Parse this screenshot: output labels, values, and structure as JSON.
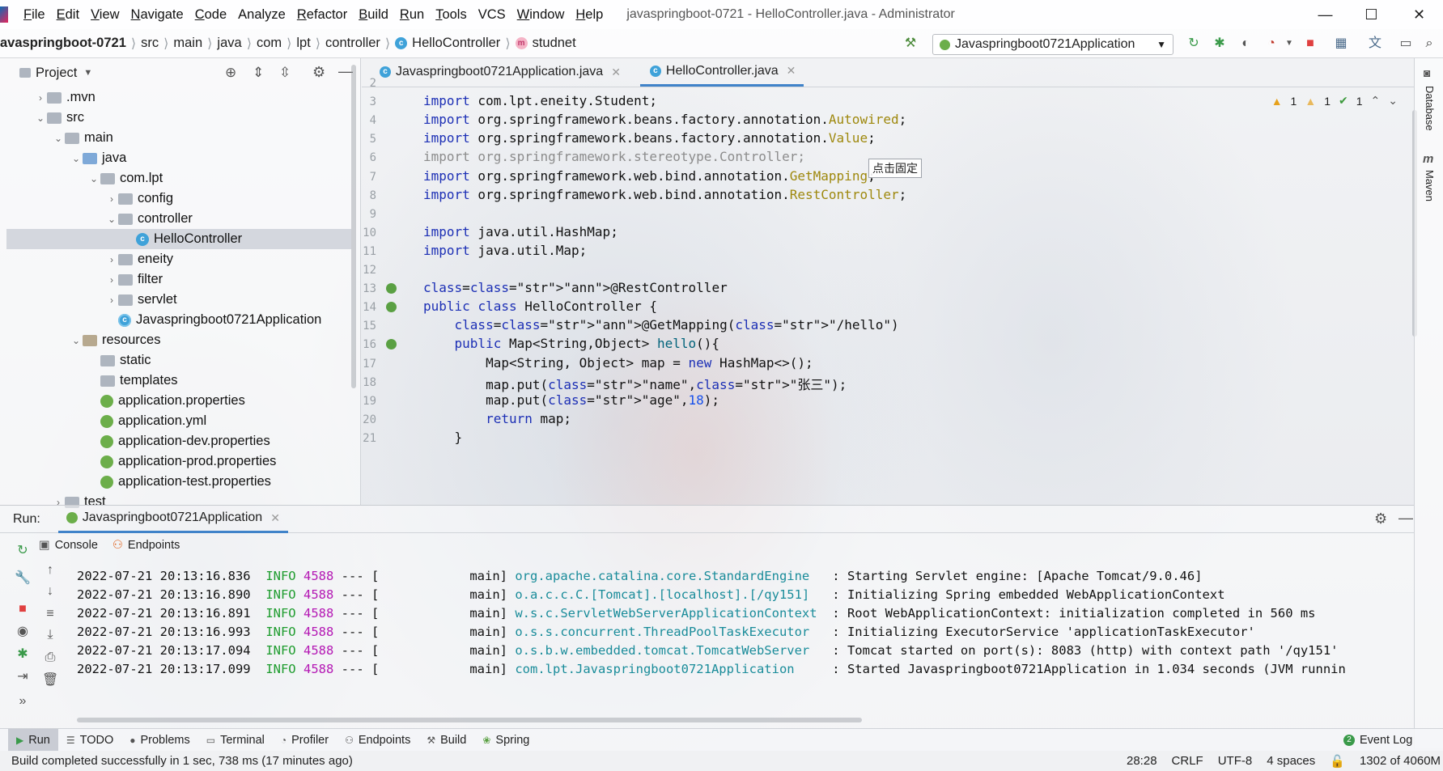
{
  "window": {
    "title": "javaspringboot-0721 - HelloController.java - Administrator",
    "controls": {
      "minimize": "—",
      "maximize": "☐",
      "close": "✕"
    }
  },
  "menu": [
    {
      "label": "File",
      "mn": "F",
      "rest": "ile"
    },
    {
      "label": "Edit",
      "mn": "E",
      "rest": "dit"
    },
    {
      "label": "View",
      "mn": "V",
      "rest": "iew"
    },
    {
      "label": "Navigate",
      "mn": "N",
      "rest": "avigate"
    },
    {
      "label": "Code",
      "mn": "C",
      "rest": "ode"
    },
    {
      "label": "Analyze",
      "mn": "",
      "rest": "Analyze"
    },
    {
      "label": "Refactor",
      "mn": "R",
      "rest": "efactor"
    },
    {
      "label": "Build",
      "mn": "B",
      "rest": "uild"
    },
    {
      "label": "Run",
      "mn": "R",
      "rest": "un"
    },
    {
      "label": "Tools",
      "mn": "T",
      "rest": "ools"
    },
    {
      "label": "VCS",
      "mn": "",
      "rest": "VCS"
    },
    {
      "label": "Window",
      "mn": "W",
      "rest": "indow"
    },
    {
      "label": "Help",
      "mn": "H",
      "rest": "elp"
    }
  ],
  "breadcrumb": {
    "items": [
      "avaspringboot-0721",
      "src",
      "main",
      "java",
      "com",
      "lpt",
      "controller",
      "HelloController",
      "studnet"
    ]
  },
  "toolbar": {
    "run_config": "Javaspringboot0721Application"
  },
  "project_panel": {
    "title": "Project",
    "tree": [
      {
        "label": ".mvn",
        "depth": 1,
        "arrow": "›",
        "kind": "folder"
      },
      {
        "label": "src",
        "depth": 1,
        "arrow": "⌄",
        "kind": "folder"
      },
      {
        "label": "main",
        "depth": 2,
        "arrow": "⌄",
        "kind": "folder"
      },
      {
        "label": "java",
        "depth": 3,
        "arrow": "⌄",
        "kind": "folder-blue"
      },
      {
        "label": "com.lpt",
        "depth": 4,
        "arrow": "⌄",
        "kind": "folder"
      },
      {
        "label": "config",
        "depth": 5,
        "arrow": "›",
        "kind": "folder"
      },
      {
        "label": "controller",
        "depth": 5,
        "arrow": "⌄",
        "kind": "folder"
      },
      {
        "label": "HelloController",
        "depth": 6,
        "arrow": "",
        "kind": "class",
        "selected": true
      },
      {
        "label": "eneity",
        "depth": 5,
        "arrow": "›",
        "kind": "folder"
      },
      {
        "label": "filter",
        "depth": 5,
        "arrow": "›",
        "kind": "folder"
      },
      {
        "label": "servlet",
        "depth": 5,
        "arrow": "›",
        "kind": "folder"
      },
      {
        "label": "Javaspringboot0721Application",
        "depth": 5,
        "arrow": "",
        "kind": "app"
      },
      {
        "label": "resources",
        "depth": 3,
        "arrow": "⌄",
        "kind": "folder-res"
      },
      {
        "label": "static",
        "depth": 4,
        "arrow": "",
        "kind": "folder"
      },
      {
        "label": "templates",
        "depth": 4,
        "arrow": "",
        "kind": "folder"
      },
      {
        "label": "application.properties",
        "depth": 4,
        "arrow": "",
        "kind": "spring"
      },
      {
        "label": "application.yml",
        "depth": 4,
        "arrow": "",
        "kind": "spring"
      },
      {
        "label": "application-dev.properties",
        "depth": 4,
        "arrow": "",
        "kind": "spring"
      },
      {
        "label": "application-prod.properties",
        "depth": 4,
        "arrow": "",
        "kind": "spring"
      },
      {
        "label": "application-test.properties",
        "depth": 4,
        "arrow": "",
        "kind": "spring"
      },
      {
        "label": "test",
        "depth": 2,
        "arrow": "›",
        "kind": "folder"
      }
    ]
  },
  "editor": {
    "tabs": [
      {
        "label": "Javaspringboot0721Application.java",
        "active": false
      },
      {
        "label": "HelloController.java",
        "active": true
      }
    ],
    "inspections": {
      "warn_a": "1",
      "warn_b": "1",
      "ok": "1"
    },
    "tooltip": "点击固定",
    "line_numbers": [
      "2",
      "3",
      "4",
      "5",
      "6",
      "7",
      "8",
      "9",
      "10",
      "11",
      "12",
      "13",
      "14",
      "15",
      "16",
      "17",
      "18",
      "19",
      "20",
      "21"
    ],
    "lines": [
      "",
      "import com.lpt.eneity.Student;",
      "import org.springframework.beans.factory.annotation.Autowired;",
      "import org.springframework.beans.factory.annotation.Value;",
      "import org.springframework.stereotype.Controller;",
      "import org.springframework.web.bind.annotation.GetMapping;",
      "import org.springframework.web.bind.annotation.RestController;",
      "",
      "import java.util.HashMap;",
      "import java.util.Map;",
      "",
      "@RestController",
      "public class HelloController {",
      "    @GetMapping(\"/hello\")",
      "    public Map<String,Object> hello(){",
      "        Map<String, Object> map = new HashMap<>();",
      "        map.put(\"name\",\"张三\");",
      "        map.put(\"age\",18);",
      "        return map;",
      "    }"
    ]
  },
  "right_strip": {
    "database": "Database",
    "maven": "Maven"
  },
  "run_panel": {
    "label": "Run:",
    "config": "Javaspringboot0721Application",
    "subtabs": [
      "Console",
      "Endpoints"
    ],
    "logs": [
      {
        "time": "2022-07-21 20:13:16.836",
        "level": "INFO",
        "pid": "4588",
        "sep": "--- [",
        "thread": "           main]",
        "logger": "org.apache.catalina.core.StandardEngine  ",
        "msg": ": Starting Servlet engine: [Apache Tomcat/9.0.46]"
      },
      {
        "time": "2022-07-21 20:13:16.890",
        "level": "INFO",
        "pid": "4588",
        "sep": "--- [",
        "thread": "           main]",
        "logger": "o.a.c.c.C.[Tomcat].[localhost].[/qy151]  ",
        "msg": ": Initializing Spring embedded WebApplicationContext"
      },
      {
        "time": "2022-07-21 20:13:16.891",
        "level": "INFO",
        "pid": "4588",
        "sep": "--- [",
        "thread": "           main]",
        "logger": "w.s.c.ServletWebServerApplicationContext ",
        "msg": ": Root WebApplicationContext: initialization completed in 560 ms"
      },
      {
        "time": "2022-07-21 20:13:16.993",
        "level": "INFO",
        "pid": "4588",
        "sep": "--- [",
        "thread": "           main]",
        "logger": "o.s.s.concurrent.ThreadPoolTaskExecutor  ",
        "msg": ": Initializing ExecutorService 'applicationTaskExecutor'"
      },
      {
        "time": "2022-07-21 20:13:17.094",
        "level": "INFO",
        "pid": "4588",
        "sep": "--- [",
        "thread": "           main]",
        "logger": "o.s.b.w.embedded.tomcat.TomcatWebServer  ",
        "msg": ": Tomcat started on port(s): 8083 (http) with context path '/qy151'"
      },
      {
        "time": "2022-07-21 20:13:17.099",
        "level": "INFO",
        "pid": "4588",
        "sep": "--- [",
        "thread": "           main]",
        "logger": "com.lpt.Javaspringboot0721Application    ",
        "msg": ": Started Javaspringboot0721Application in 1.034 seconds (JVM runnin"
      }
    ]
  },
  "tool_buttons": [
    "Run",
    "TODO",
    "Problems",
    "Terminal",
    "Profiler",
    "Endpoints",
    "Build",
    "Spring"
  ],
  "event_log": "Event Log",
  "status": {
    "message": "Build completed successfully in 1 sec, 738 ms (17 minutes ago)",
    "position": "28:28",
    "line_sep": "CRLF",
    "encoding": "UTF-8",
    "indent": "4 spaces",
    "memory": "1302 of 4060M"
  },
  "colors": {
    "accent": "#4083c9",
    "info": "#1e9c2e",
    "pid": "#b418b4",
    "logger": "#1a8c9a"
  }
}
